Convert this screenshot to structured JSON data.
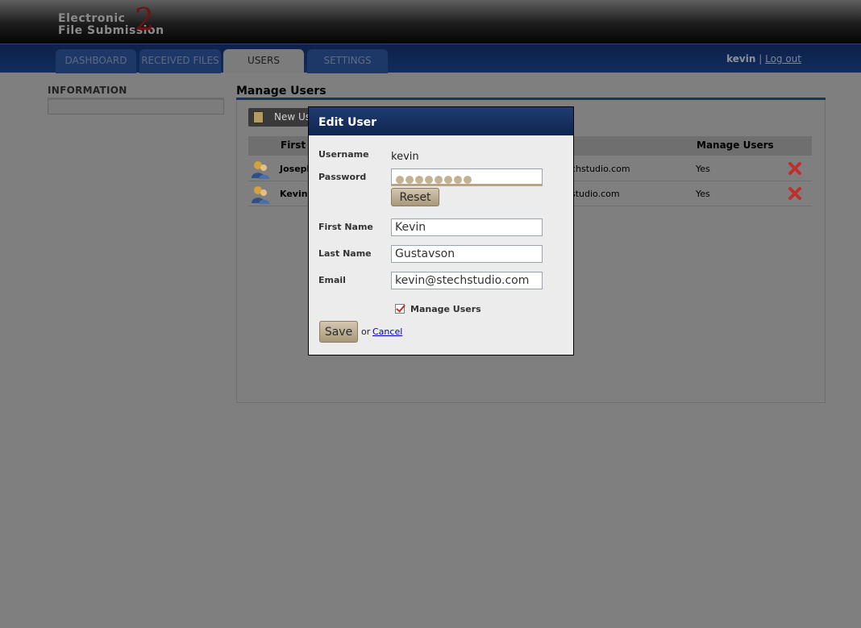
{
  "app": {
    "logo_line1": "Electronic",
    "logo_line2": "File Submission",
    "logo_mark": "2"
  },
  "nav": {
    "tabs": [
      {
        "label": "DASHBOARD",
        "active": false
      },
      {
        "label": "RECEIVED FILES",
        "active": false
      },
      {
        "label": "USERS",
        "active": true
      },
      {
        "label": "SETTINGS",
        "active": false
      }
    ],
    "username": "kevin",
    "separator": "|",
    "logout": "Log out"
  },
  "sidebar": {
    "title": "INFORMATION"
  },
  "main": {
    "title": "Manage Users",
    "new_button": "New Us",
    "columns": [
      "First N",
      "Manage Users"
    ],
    "rows": [
      {
        "first_name": "Joseph",
        "email": "chstudio.com",
        "manage_users": "Yes"
      },
      {
        "first_name": "Kevin",
        "email": "studio.com",
        "manage_users": "Yes"
      }
    ]
  },
  "modal": {
    "title": "Edit User",
    "username_label": "Username",
    "username_value": "kevin",
    "password_label": "Password",
    "password_dots": 8,
    "reset_button": "Reset",
    "first_name_label": "First Name",
    "first_name_value": "Kevin",
    "last_name_label": "Last Name",
    "last_name_value": "Gustavson",
    "email_label": "Email",
    "email_value": "kevin@stechstudio.com",
    "manage_users_label": "Manage Users",
    "manage_users_checked": true,
    "save_button": "Save",
    "or_text": "or",
    "cancel_link": "Cancel"
  },
  "colors": {
    "nav_blue": "#122c5d",
    "modal_header": "#203c73",
    "button_tan": "#c4b294",
    "delete_red": "#c0302a"
  }
}
